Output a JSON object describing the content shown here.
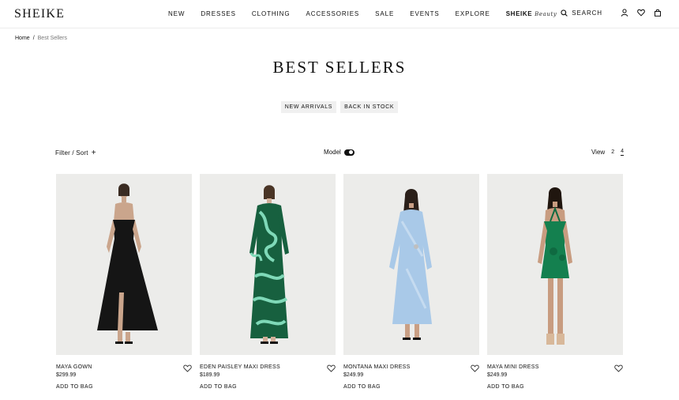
{
  "header": {
    "logo": "SHEIKE",
    "nav": [
      "NEW",
      "DRESSES",
      "CLOTHING",
      "ACCESSORIES",
      "SALE",
      "EVENTS",
      "EXPLORE"
    ],
    "brand_link": {
      "label": "SHEIKE",
      "script": "Beauty"
    },
    "search_label": "SEARCH",
    "icons": [
      "search-icon",
      "account-icon",
      "wishlist-icon",
      "bag-icon"
    ]
  },
  "breadcrumb": {
    "home": "Home",
    "separator": "/",
    "current": "Best Sellers"
  },
  "page": {
    "title": "BEST SELLERS"
  },
  "chips": [
    "NEW ARRIVALS",
    "BACK IN STOCK"
  ],
  "toolbar": {
    "filter_label": "Filter / Sort",
    "filter_icon": "+",
    "model_label": "Model",
    "model_on": true,
    "view_label": "View",
    "view_options": [
      "2",
      "4"
    ],
    "view_selected": "4"
  },
  "products": [
    {
      "name": "MAYA GOWN",
      "price": "$299.99",
      "add_label": "ADD TO BAG",
      "dress_color": "#151515",
      "accent_color": "#151515"
    },
    {
      "name": "EDEN PAISLEY MAXI DRESS",
      "price": "$189.99",
      "add_label": "ADD TO BAG",
      "dress_color": "#17603f",
      "accent_color": "#7fd9b8"
    },
    {
      "name": "MONTANA MAXI DRESS",
      "price": "$249.99",
      "add_label": "ADD TO BAG",
      "dress_color": "#a9c9e8",
      "accent_color": "#c5dbf0"
    },
    {
      "name": "MAYA MINI DRESS",
      "price": "$249.99",
      "add_label": "ADD TO BAG",
      "dress_color": "#14804f",
      "accent_color": "#0f6a41"
    }
  ]
}
